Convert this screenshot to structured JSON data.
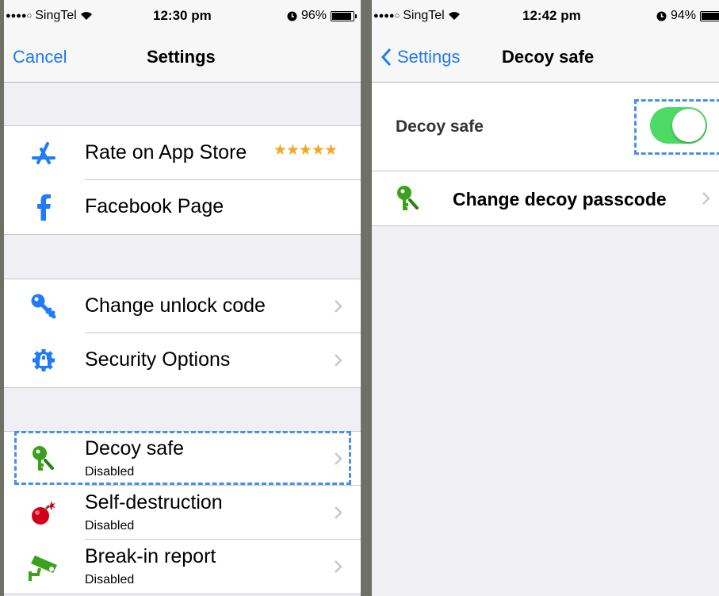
{
  "left": {
    "status": {
      "carrier": "SingTel",
      "time": "12:30 pm",
      "battery": "96%",
      "battery_level": 0.96
    },
    "nav": {
      "cancel": "Cancel",
      "title": "Settings"
    },
    "group1": [
      {
        "label": "Rate on App Store",
        "stars": "★★★★★"
      },
      {
        "label": "Facebook Page"
      }
    ],
    "group2": [
      {
        "label": "Change unlock code"
      },
      {
        "label": "Security Options"
      }
    ],
    "group3": [
      {
        "label": "Decoy safe",
        "status": "Disabled"
      },
      {
        "label": "Self-destruction",
        "status": "Disabled"
      },
      {
        "label": "Break-in report",
        "status": "Disabled"
      }
    ]
  },
  "right": {
    "status": {
      "carrier": "SingTel",
      "time": "12:42 pm",
      "battery": "94%",
      "battery_level": 0.94
    },
    "nav": {
      "back": "Settings",
      "title": "Decoy safe"
    },
    "toggle_row": {
      "label": "Decoy safe",
      "enabled": true
    },
    "passcode_row": {
      "label": "Change decoy passcode"
    }
  },
  "colors": {
    "accent": "#1f7bf6",
    "toggle_on": "#4cd964",
    "highlight": "#4a90e2",
    "star": "#f5a623"
  }
}
